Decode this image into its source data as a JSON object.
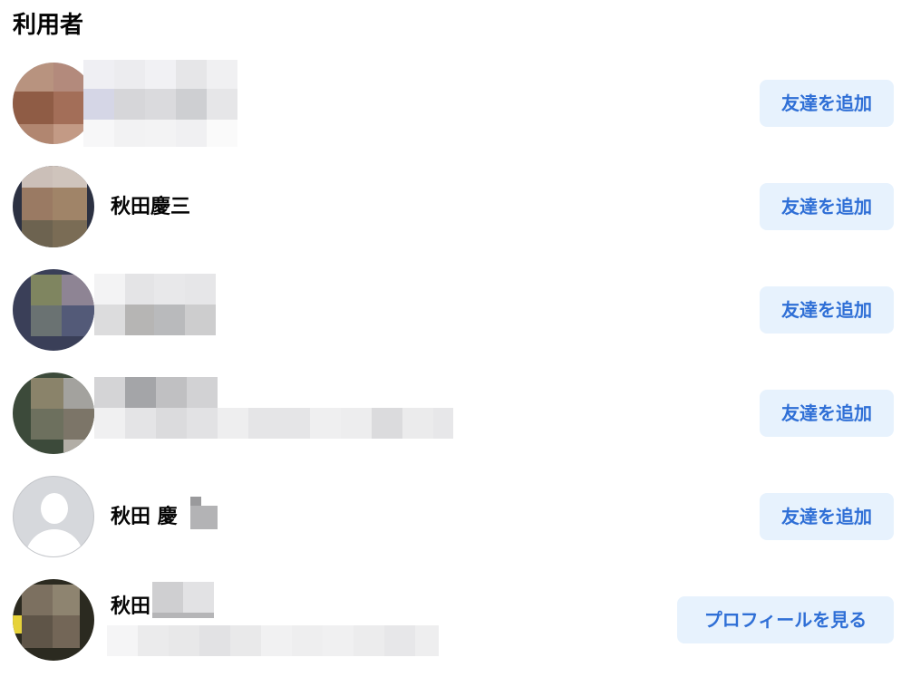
{
  "section": {
    "title": "利用者"
  },
  "people": [
    {
      "name": "",
      "action": "友達を追加"
    },
    {
      "name": "秋田慶三",
      "action": "友達を追加"
    },
    {
      "name": "",
      "action": "友達を追加"
    },
    {
      "name": "",
      "action": "友達を追加"
    },
    {
      "name": "秋田 慶",
      "action": "友達を追加"
    },
    {
      "name": "秋田",
      "action": "プロフィールを見る"
    }
  ],
  "icons": {
    "default_avatar": "person-silhouette-icon"
  },
  "colors": {
    "button_bg": "#e7f2fd",
    "button_text": "#2f6fd6",
    "text": "#050505",
    "avatar_placeholder": "#d6d8dc"
  }
}
